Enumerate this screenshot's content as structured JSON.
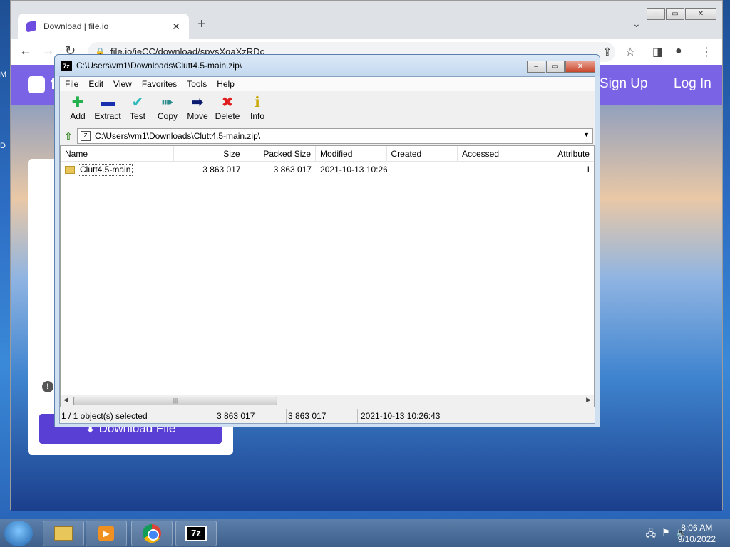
{
  "desktop": {
    "icon_labels": [
      "M",
      "D"
    ]
  },
  "chrome": {
    "tab_title": "Download | file.io",
    "tab_close": "✕",
    "new_tab": "+",
    "url": "file.io/ieCC/download/spysXgaXzRDc",
    "window_buttons": {
      "minimize": "–",
      "maximize": "▭",
      "close": "✕"
    }
  },
  "site": {
    "signup": "Sign Up",
    "login": "Log In",
    "download_button": "Download File",
    "logo_letter": "f"
  },
  "sevenzip": {
    "title": "C:\\Users\\vm1\\Downloads\\Clutt4.5-main.zip\\",
    "app_icon": "7z",
    "menu": [
      "File",
      "Edit",
      "View",
      "Favorites",
      "Tools",
      "Help"
    ],
    "toolbar": [
      {
        "label": "Add",
        "icon": "plus-icon"
      },
      {
        "label": "Extract",
        "icon": "minus-icon"
      },
      {
        "label": "Test",
        "icon": "check-icon"
      },
      {
        "label": "Copy",
        "icon": "double-arrow-icon"
      },
      {
        "label": "Move",
        "icon": "arrow-right-icon"
      },
      {
        "label": "Delete",
        "icon": "x-icon"
      },
      {
        "label": "Info",
        "icon": "info-icon"
      }
    ],
    "address": "C:\\Users\\vm1\\Downloads\\Clutt4.5-main.zip\\",
    "columns": [
      "Name",
      "Size",
      "Packed Size",
      "Modified",
      "Created",
      "Accessed",
      "Attribute"
    ],
    "rows": [
      {
        "name": "Clutt4.5-main",
        "size": "3 863 017",
        "packed": "3 863 017",
        "modified": "2021-10-13 10:26",
        "created": "",
        "accessed": "",
        "attr": "I"
      }
    ],
    "status": {
      "selected": "1 / 1 object(s) selected",
      "size": "3 863 017",
      "packed": "3 863 017",
      "modified": "2021-10-13 10:26:43"
    }
  },
  "taskbar": {
    "time": "8:06 AM",
    "date": "9/10/2022",
    "sevenzip_label": "7z"
  }
}
